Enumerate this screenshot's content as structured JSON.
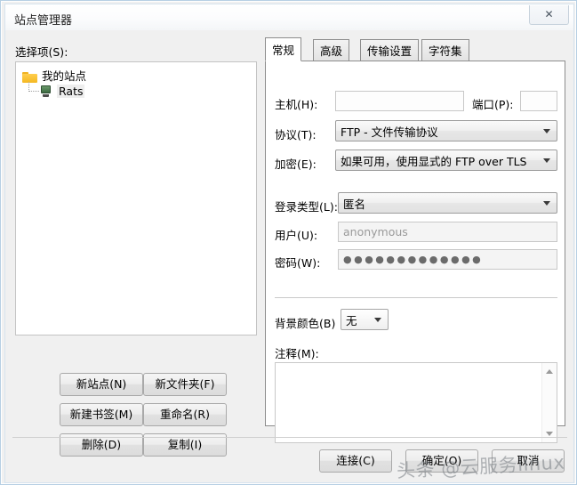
{
  "window": {
    "title": "站点管理器",
    "close_icon": "close-icon",
    "close_glyph": "✕"
  },
  "left": {
    "select_label": "选择项(S):",
    "tree": [
      {
        "label": "我的站点",
        "icon": "folder-icon",
        "selected": false
      },
      {
        "label": "Rats",
        "icon": "server-icon",
        "selected": true
      }
    ],
    "buttons": [
      {
        "label": "新站点(N)"
      },
      {
        "label": "新文件夹(F)"
      },
      {
        "label": "新建书签(M)"
      },
      {
        "label": "重命名(R)"
      },
      {
        "label": "删除(D)"
      },
      {
        "label": "复制(I)"
      }
    ]
  },
  "tabs": [
    {
      "label": "常规",
      "active": true
    },
    {
      "label": "高级",
      "active": false
    },
    {
      "label": "传输设置",
      "active": false
    },
    {
      "label": "字符集",
      "active": false
    }
  ],
  "general": {
    "host_label": "主机(H):",
    "host_value": "",
    "port_label": "端口(P):",
    "port_value": "",
    "protocol_label": "协议(T):",
    "protocol_value": "FTP - 文件传输协议",
    "encryption_label": "加密(E):",
    "encryption_value": "如果可用，使用显式的 FTP over TLS",
    "logontype_label": "登录类型(L):",
    "logontype_value": "匿名",
    "user_label": "用户(U):",
    "user_value": "anonymous",
    "password_label": "密码(W):",
    "password_value": "●●●●●●●●●●●●●",
    "bgcolor_label": "背景颜色(B)",
    "bgcolor_value": "无",
    "comment_label": "注释(M):",
    "comment_value": ""
  },
  "footer": {
    "connect_label": "连接(C)",
    "ok_label": "确定(O)",
    "cancel_label": "取消"
  },
  "watermark": {
    "text": "头条 @云服务linux"
  }
}
